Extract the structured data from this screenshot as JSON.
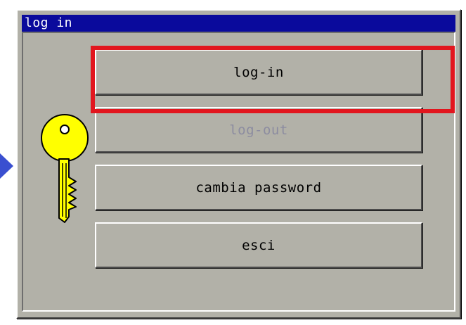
{
  "window": {
    "title": "log in"
  },
  "buttons": {
    "login_label": "log-in",
    "logout_label": "log-out",
    "change_password_label": "cambia password",
    "exit_label": "esci"
  },
  "icons": {
    "key": "key-icon",
    "pointer": "arrow-right-icon"
  },
  "colors": {
    "title_bar": "#0a0a9c",
    "window_face": "#b2b1a8",
    "highlight": "#e2161e",
    "key": "#ffff00",
    "pointer": "#3a4fd0",
    "disabled_text": "#8c8ca0"
  },
  "states": {
    "logout_enabled": false
  }
}
